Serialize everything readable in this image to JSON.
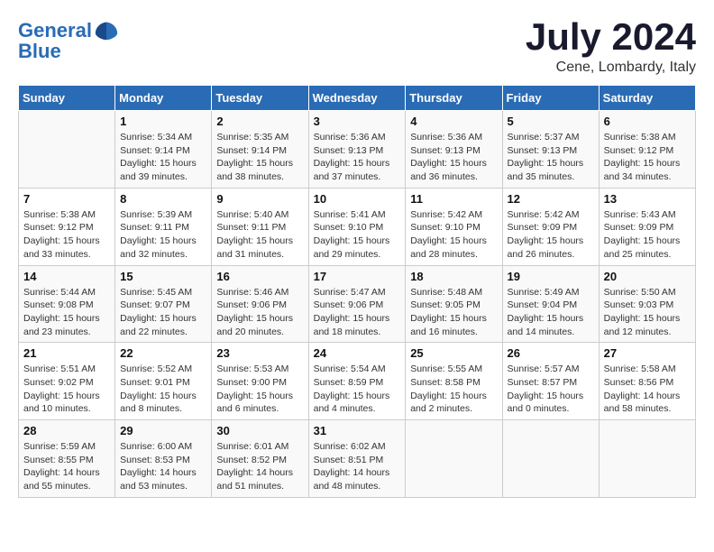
{
  "header": {
    "logo_line1": "General",
    "logo_line2": "Blue",
    "month_title": "July 2024",
    "location": "Cene, Lombardy, Italy"
  },
  "columns": [
    "Sunday",
    "Monday",
    "Tuesday",
    "Wednesday",
    "Thursday",
    "Friday",
    "Saturday"
  ],
  "weeks": [
    [
      {
        "day": "",
        "info": ""
      },
      {
        "day": "1",
        "info": "Sunrise: 5:34 AM\nSunset: 9:14 PM\nDaylight: 15 hours\nand 39 minutes."
      },
      {
        "day": "2",
        "info": "Sunrise: 5:35 AM\nSunset: 9:14 PM\nDaylight: 15 hours\nand 38 minutes."
      },
      {
        "day": "3",
        "info": "Sunrise: 5:36 AM\nSunset: 9:13 PM\nDaylight: 15 hours\nand 37 minutes."
      },
      {
        "day": "4",
        "info": "Sunrise: 5:36 AM\nSunset: 9:13 PM\nDaylight: 15 hours\nand 36 minutes."
      },
      {
        "day": "5",
        "info": "Sunrise: 5:37 AM\nSunset: 9:13 PM\nDaylight: 15 hours\nand 35 minutes."
      },
      {
        "day": "6",
        "info": "Sunrise: 5:38 AM\nSunset: 9:12 PM\nDaylight: 15 hours\nand 34 minutes."
      }
    ],
    [
      {
        "day": "7",
        "info": "Sunrise: 5:38 AM\nSunset: 9:12 PM\nDaylight: 15 hours\nand 33 minutes."
      },
      {
        "day": "8",
        "info": "Sunrise: 5:39 AM\nSunset: 9:11 PM\nDaylight: 15 hours\nand 32 minutes."
      },
      {
        "day": "9",
        "info": "Sunrise: 5:40 AM\nSunset: 9:11 PM\nDaylight: 15 hours\nand 31 minutes."
      },
      {
        "day": "10",
        "info": "Sunrise: 5:41 AM\nSunset: 9:10 PM\nDaylight: 15 hours\nand 29 minutes."
      },
      {
        "day": "11",
        "info": "Sunrise: 5:42 AM\nSunset: 9:10 PM\nDaylight: 15 hours\nand 28 minutes."
      },
      {
        "day": "12",
        "info": "Sunrise: 5:42 AM\nSunset: 9:09 PM\nDaylight: 15 hours\nand 26 minutes."
      },
      {
        "day": "13",
        "info": "Sunrise: 5:43 AM\nSunset: 9:09 PM\nDaylight: 15 hours\nand 25 minutes."
      }
    ],
    [
      {
        "day": "14",
        "info": "Sunrise: 5:44 AM\nSunset: 9:08 PM\nDaylight: 15 hours\nand 23 minutes."
      },
      {
        "day": "15",
        "info": "Sunrise: 5:45 AM\nSunset: 9:07 PM\nDaylight: 15 hours\nand 22 minutes."
      },
      {
        "day": "16",
        "info": "Sunrise: 5:46 AM\nSunset: 9:06 PM\nDaylight: 15 hours\nand 20 minutes."
      },
      {
        "day": "17",
        "info": "Sunrise: 5:47 AM\nSunset: 9:06 PM\nDaylight: 15 hours\nand 18 minutes."
      },
      {
        "day": "18",
        "info": "Sunrise: 5:48 AM\nSunset: 9:05 PM\nDaylight: 15 hours\nand 16 minutes."
      },
      {
        "day": "19",
        "info": "Sunrise: 5:49 AM\nSunset: 9:04 PM\nDaylight: 15 hours\nand 14 minutes."
      },
      {
        "day": "20",
        "info": "Sunrise: 5:50 AM\nSunset: 9:03 PM\nDaylight: 15 hours\nand 12 minutes."
      }
    ],
    [
      {
        "day": "21",
        "info": "Sunrise: 5:51 AM\nSunset: 9:02 PM\nDaylight: 15 hours\nand 10 minutes."
      },
      {
        "day": "22",
        "info": "Sunrise: 5:52 AM\nSunset: 9:01 PM\nDaylight: 15 hours\nand 8 minutes."
      },
      {
        "day": "23",
        "info": "Sunrise: 5:53 AM\nSunset: 9:00 PM\nDaylight: 15 hours\nand 6 minutes."
      },
      {
        "day": "24",
        "info": "Sunrise: 5:54 AM\nSunset: 8:59 PM\nDaylight: 15 hours\nand 4 minutes."
      },
      {
        "day": "25",
        "info": "Sunrise: 5:55 AM\nSunset: 8:58 PM\nDaylight: 15 hours\nand 2 minutes."
      },
      {
        "day": "26",
        "info": "Sunrise: 5:57 AM\nSunset: 8:57 PM\nDaylight: 15 hours\nand 0 minutes."
      },
      {
        "day": "27",
        "info": "Sunrise: 5:58 AM\nSunset: 8:56 PM\nDaylight: 14 hours\nand 58 minutes."
      }
    ],
    [
      {
        "day": "28",
        "info": "Sunrise: 5:59 AM\nSunset: 8:55 PM\nDaylight: 14 hours\nand 55 minutes."
      },
      {
        "day": "29",
        "info": "Sunrise: 6:00 AM\nSunset: 8:53 PM\nDaylight: 14 hours\nand 53 minutes."
      },
      {
        "day": "30",
        "info": "Sunrise: 6:01 AM\nSunset: 8:52 PM\nDaylight: 14 hours\nand 51 minutes."
      },
      {
        "day": "31",
        "info": "Sunrise: 6:02 AM\nSunset: 8:51 PM\nDaylight: 14 hours\nand 48 minutes."
      },
      {
        "day": "",
        "info": ""
      },
      {
        "day": "",
        "info": ""
      },
      {
        "day": "",
        "info": ""
      }
    ]
  ]
}
